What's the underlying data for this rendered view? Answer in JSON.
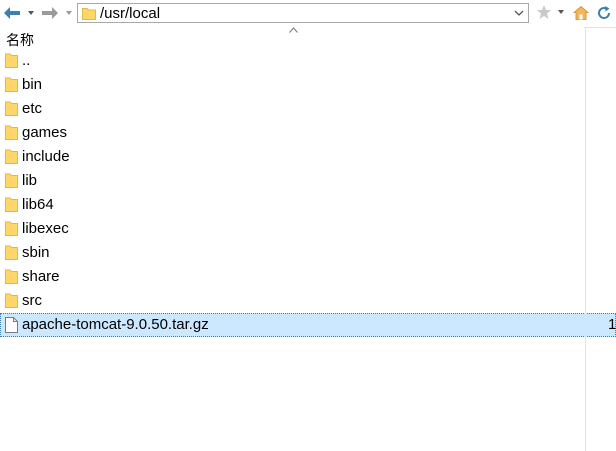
{
  "toolbar": {
    "back_icon": "arrow-left-icon",
    "forward_icon": "arrow-right-icon",
    "path": "/usr/local",
    "bookmark_icon": "star-icon",
    "home_icon": "home-icon",
    "refresh_icon": "refresh-icon"
  },
  "columns": {
    "name": "名称"
  },
  "files": [
    {
      "name": "..",
      "type": "folder"
    },
    {
      "name": "bin",
      "type": "folder"
    },
    {
      "name": "etc",
      "type": "folder"
    },
    {
      "name": "games",
      "type": "folder"
    },
    {
      "name": "include",
      "type": "folder"
    },
    {
      "name": "lib",
      "type": "folder"
    },
    {
      "name": "lib64",
      "type": "folder"
    },
    {
      "name": "libexec",
      "type": "folder"
    },
    {
      "name": "sbin",
      "type": "folder"
    },
    {
      "name": "share",
      "type": "folder"
    },
    {
      "name": "src",
      "type": "folder"
    },
    {
      "name": "apache-tomcat-9.0.50.tar.gz",
      "type": "file",
      "selected": true,
      "size": "1"
    }
  ],
  "colors": {
    "folder": "#ffd768",
    "selection": "#cce8ff",
    "nav_arrow": "#3c7fb1"
  }
}
